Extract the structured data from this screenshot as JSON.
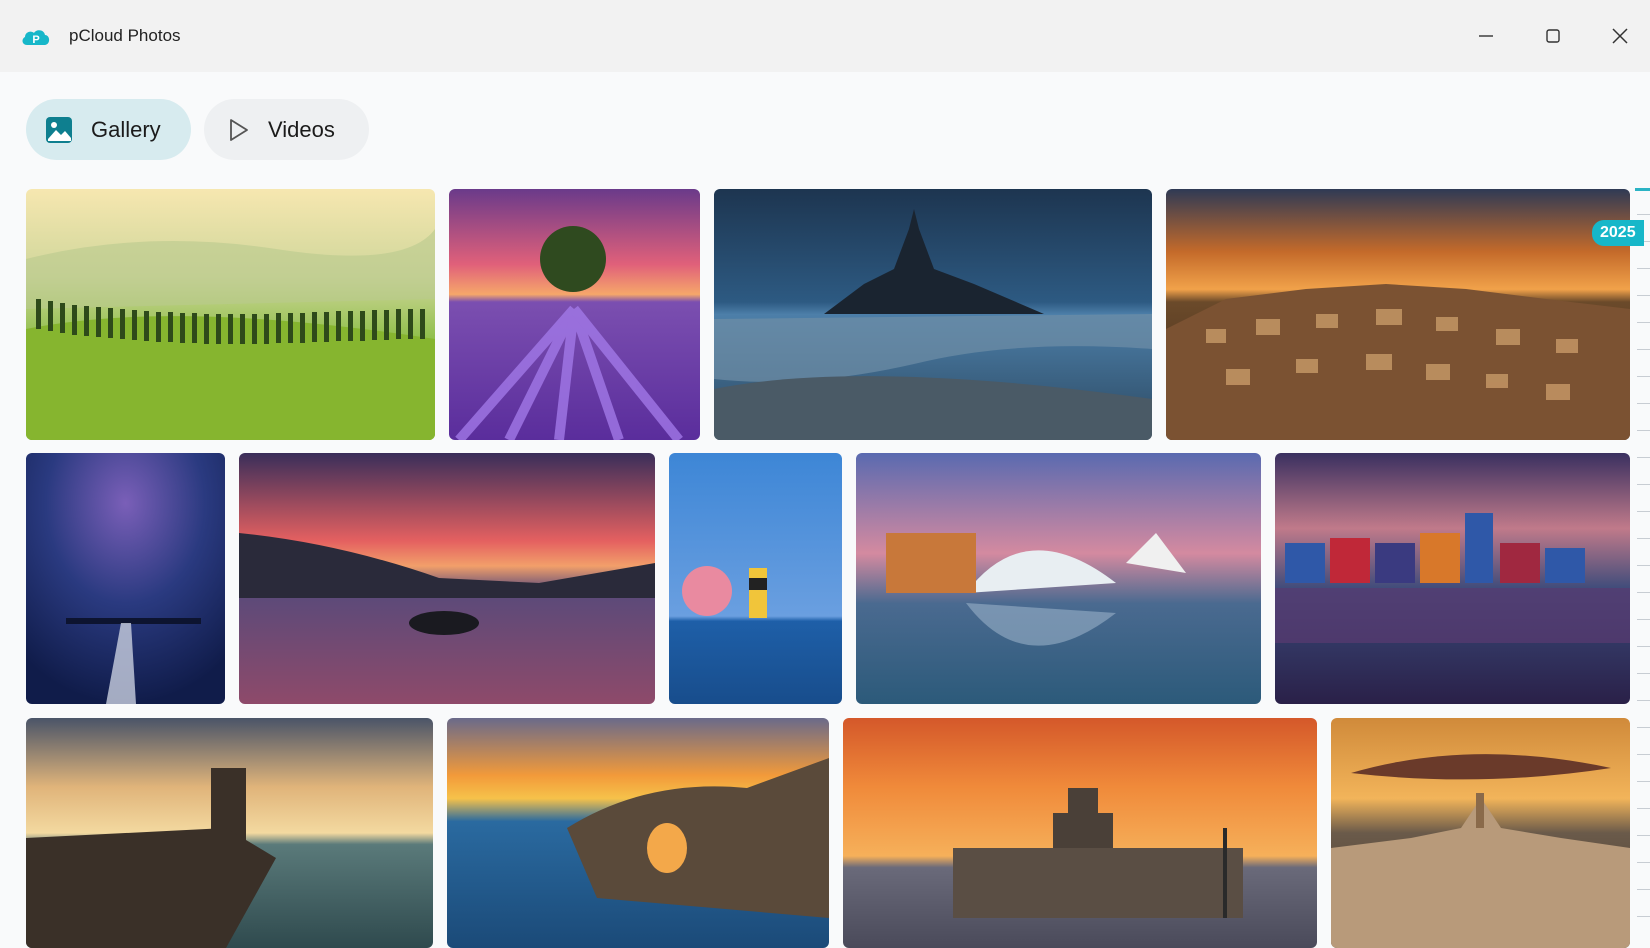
{
  "app": {
    "title": "pCloud Photos",
    "logo_icon": "pcloud-logo-icon",
    "logo_letter": "P",
    "accent_color": "#17b7c9"
  },
  "window_controls": {
    "minimize_icon": "minimize-icon",
    "maximize_icon": "maximize-icon",
    "close_icon": "close-icon"
  },
  "tabs": [
    {
      "label": "Gallery",
      "icon": "image-icon",
      "selected": true
    },
    {
      "label": "Videos",
      "icon": "play-icon",
      "selected": false
    }
  ],
  "gallery": {
    "year_badge": "2025",
    "photos": [
      {
        "subject": "Green rolling hills with cypress trees"
      },
      {
        "subject": "Lone tree in lavender field at sunset"
      },
      {
        "subject": "Island abbey at dusk reflected on tidal flats"
      },
      {
        "subject": "Hillside town at sunset"
      },
      {
        "subject": "Pier in blue fog"
      },
      {
        "subject": "Small island on lake at sunset"
      },
      {
        "subject": "Lighthouse and pink moon"
      },
      {
        "subject": "Futuristic architecture reflected in water"
      },
      {
        "subject": "Colorful waterfront houses reflected"
      },
      {
        "subject": "Stone lighthouse on rocky coast"
      },
      {
        "subject": "Rock arch over sea at sunset"
      },
      {
        "subject": "Harbor fortress at sunset"
      },
      {
        "subject": "Ancient hilltop city at sunset"
      }
    ]
  }
}
